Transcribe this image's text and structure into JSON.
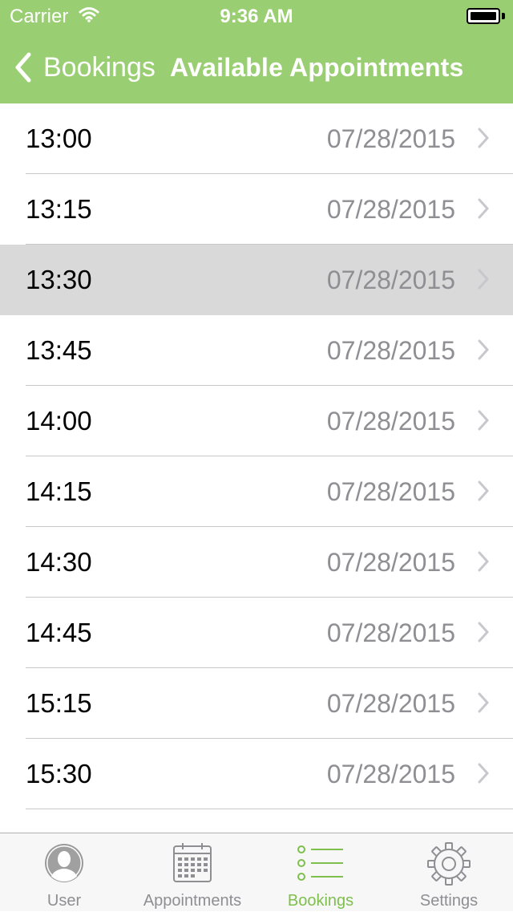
{
  "status_bar": {
    "carrier": "Carrier",
    "time": "9:36 AM"
  },
  "nav": {
    "back_label": "Bookings",
    "title": "Available Appointments"
  },
  "appointments": [
    {
      "time": "13:00",
      "date": "07/28/2015",
      "selected": false
    },
    {
      "time": "13:15",
      "date": "07/28/2015",
      "selected": false
    },
    {
      "time": "13:30",
      "date": "07/28/2015",
      "selected": true
    },
    {
      "time": "13:45",
      "date": "07/28/2015",
      "selected": false
    },
    {
      "time": "14:00",
      "date": "07/28/2015",
      "selected": false
    },
    {
      "time": "14:15",
      "date": "07/28/2015",
      "selected": false
    },
    {
      "time": "14:30",
      "date": "07/28/2015",
      "selected": false
    },
    {
      "time": "14:45",
      "date": "07/28/2015",
      "selected": false
    },
    {
      "time": "15:15",
      "date": "07/28/2015",
      "selected": false
    },
    {
      "time": "15:30",
      "date": "07/28/2015",
      "selected": false
    }
  ],
  "tabbar": {
    "tabs": [
      {
        "label": "User",
        "icon": "user-icon",
        "active": false
      },
      {
        "label": "Appointments",
        "icon": "calendar-icon",
        "active": false
      },
      {
        "label": "Bookings",
        "icon": "list-icon",
        "active": true
      },
      {
        "label": "Settings",
        "icon": "gear-icon",
        "active": false
      }
    ]
  },
  "colors": {
    "accent": "#9ace72",
    "active_tab": "#7fbf4d",
    "selected_row": "#d9d9d9",
    "secondary_text": "#8e8e93"
  }
}
